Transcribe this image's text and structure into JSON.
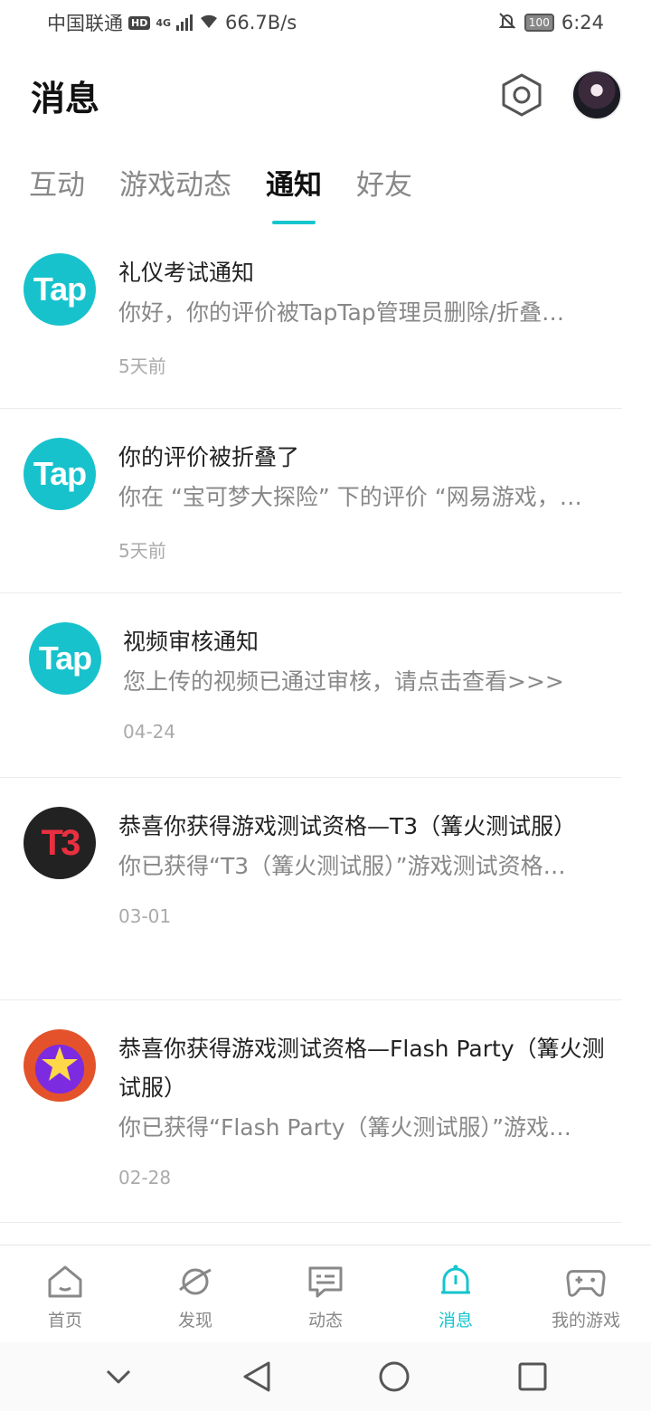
{
  "status_bar": {
    "carrier": "中国联通",
    "hd": "HD",
    "network": "4G",
    "speed": "66.7B/s",
    "battery": "100",
    "time": "6:24"
  },
  "header": {
    "title": "消息"
  },
  "tabs": [
    {
      "label": "互动",
      "active": false
    },
    {
      "label": "游戏动态",
      "active": false
    },
    {
      "label": "通知",
      "active": true
    },
    {
      "label": "好友",
      "active": false
    }
  ],
  "notifications": [
    {
      "icon": "tap-logo",
      "icon_text": "Tap",
      "title": "礼仪考试通知",
      "body": "你好，你的评价被TapTap管理员删除/折叠…",
      "time": "5天前"
    },
    {
      "icon": "tap-logo",
      "icon_text": "Tap",
      "title": "你的评价被折叠了",
      "body": "你在 “宝可梦大探险” 下的评价 “网易游戏，…",
      "time": "5天前"
    },
    {
      "icon": "tap-logo",
      "icon_text": "Tap",
      "title": "视频审核通知",
      "body": "您上传的视频已通过审核，请点击查看>>>",
      "time": "04-24"
    },
    {
      "icon": "t3-logo",
      "icon_text": "T3",
      "title": "恭喜你获得游戏测试资格—T3（篝火测试服）",
      "body": "你已获得“T3（篝火测试服）”游戏测试资格…",
      "time": "03-01"
    },
    {
      "icon": "flash-party-logo",
      "icon_text": "",
      "title": "恭喜你获得游戏测试资格—Flash Party（篝火测试服）",
      "body": "你已获得“Flash Party（篝火测试服）”游戏…",
      "time": "02-28"
    }
  ],
  "bottom_nav": [
    {
      "label": "首页",
      "icon": "home-icon",
      "active": false
    },
    {
      "label": "发现",
      "icon": "planet-icon",
      "active": false
    },
    {
      "label": "动态",
      "icon": "chat-icon",
      "active": false
    },
    {
      "label": "消息",
      "icon": "bell-icon",
      "active": true
    },
    {
      "label": "我的游戏",
      "icon": "gamepad-icon",
      "active": false
    }
  ],
  "colors": {
    "accent": "#15c5ce",
    "tap_brand": "#17c2cc"
  }
}
